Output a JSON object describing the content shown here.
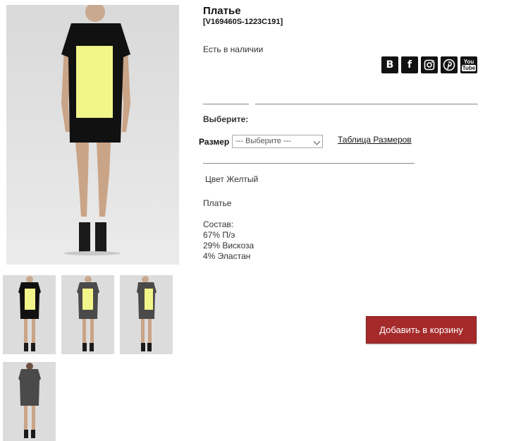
{
  "product": {
    "title": "Платье",
    "sku": "[V169460S-1223C191]",
    "availability": "Есть в наличии",
    "choose_label": "Выберите:",
    "size_label": "Размер",
    "size_selected": "--- Выберите ---",
    "size_table_link": "Таблица Размеров",
    "color": "Цвет Желтый",
    "description": "Платье",
    "composition_title": "Состав:",
    "composition": [
      "67% П/э",
      "29% Вискоза",
      "4% Эластан"
    ],
    "add_to_cart": "Добавить в корзину"
  },
  "social": [
    {
      "icon": "vk-icon",
      "glyph": "B"
    },
    {
      "icon": "facebook-icon",
      "glyph": "f"
    },
    {
      "icon": "instagram-icon",
      "glyph": ""
    },
    {
      "icon": "pinterest-icon",
      "glyph": ""
    },
    {
      "icon": "youtube-icon",
      "glyph": "You Tube"
    }
  ],
  "colors": {
    "accent_button": "#a52a2a",
    "dress_black": "#111111",
    "dress_yellow": "#f2f58a",
    "dress_grey": "#4a4a4a"
  }
}
